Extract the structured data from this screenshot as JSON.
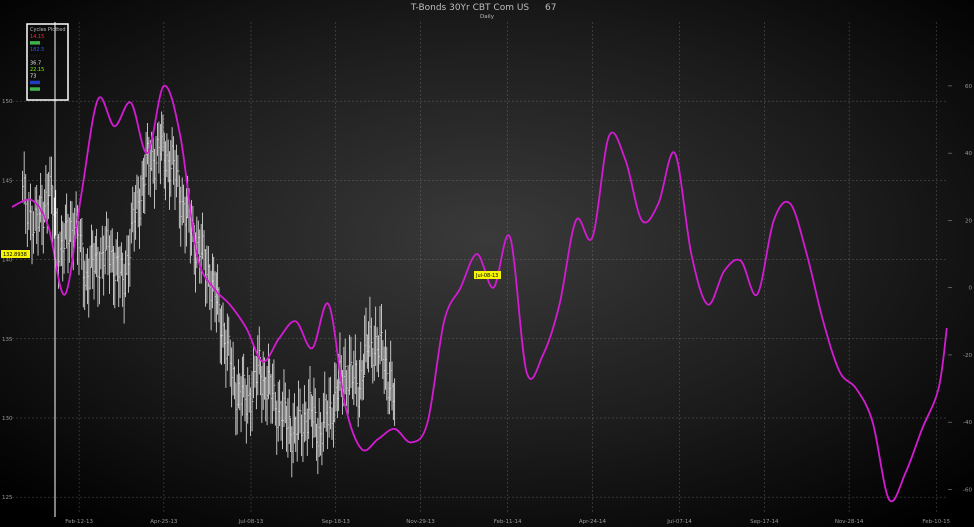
{
  "chart_data": {
    "type": "line",
    "title": "T-Bonds 30Yr CBT Com US",
    "title_value": "67",
    "subtitle": "Daily",
    "x_ticks": [
      "Feb-12-13",
      "Apr-25-13",
      "Jul-08-13",
      "Sep-18-13",
      "Nov-29-13",
      "Feb-11-14",
      "Apr-24-14",
      "Jul-07-14",
      "Sep-17-14",
      "Nov-28-14",
      "Feb-10-15"
    ],
    "xlim": [
      "Dec-17-12",
      "Feb-20-15"
    ],
    "left_axis": {
      "ticks": [
        125,
        130,
        135,
        140,
        145,
        150
      ],
      "ylim": [
        124,
        155
      ]
    },
    "right_axis": {
      "ticks": [
        -60,
        -40,
        -20,
        0,
        20,
        40,
        60
      ],
      "ylim": [
        -67,
        79
      ]
    },
    "grid": true,
    "legend": {
      "title": "Cycles Plotted",
      "placement": "top-left",
      "entries": [
        {
          "label": "14.15",
          "color": "#ff2a2a"
        },
        {
          "label": "",
          "color": "#3cb44b"
        },
        {
          "label": "182.5",
          "color": "#3b5bdb"
        },
        {
          "label": "",
          "color": "#111111"
        },
        {
          "label": "36.7",
          "color": "#e0e0e0"
        },
        {
          "label": "22.15",
          "color": "#7cfc00"
        },
        {
          "label": "73",
          "color": "#f5f5f5"
        },
        {
          "label": "",
          "color": "#1f3fbf"
        },
        {
          "label": "",
          "color": "#3cb44b"
        }
      ]
    },
    "price_label": "132.8938",
    "date_label": "Jul-08-13",
    "series": [
      {
        "axis": "left",
        "color": "#e8e8e8",
        "style": "ohlc",
        "x": [
          "Dec-26-12",
          "Jan-07-13",
          "Jan-17-13",
          "Jan-28-13",
          "Feb-07-13",
          "Feb-18-13",
          "Feb-28-13",
          "Mar-11-13",
          "Mar-21-13",
          "Apr-01-13",
          "Apr-11-13",
          "Apr-22-13",
          "May-02-13",
          "May-13-13",
          "May-23-13",
          "Jun-03-13",
          "Jun-13-13",
          "Jun-24-13",
          "Jul-04-13",
          "Jul-15-13",
          "Jul-25-13",
          "Aug-05-13",
          "Aug-15-13",
          "Aug-26-13",
          "Sep-05-13",
          "Sep-16-13",
          "Sep-26-13",
          "Oct-07-13",
          "Oct-17-13",
          "Oct-28-13",
          "Nov-07-13"
        ],
        "values": [
          144,
          142,
          144.5,
          140.5,
          142.5,
          139,
          140,
          140.5,
          138.5,
          143,
          146,
          147,
          146,
          143,
          141,
          139,
          136,
          132,
          131,
          133,
          131.5,
          130,
          129,
          130.5,
          129,
          131,
          133,
          132,
          135,
          134,
          131
        ]
      },
      {
        "axis": "right",
        "color": "#d21bd2",
        "style": "line",
        "x": [
          "Dec-17-12",
          "Jan-03-13",
          "Jan-17-13",
          "Jan-31-13",
          "Feb-14-13",
          "Feb-28-13",
          "Mar-14-13",
          "Mar-28-13",
          "Apr-11-13",
          "Apr-25-13",
          "May-09-13",
          "May-23-13",
          "Jun-06-13",
          "Jun-20-13",
          "Jul-04-13",
          "Jul-18-13",
          "Aug-01-13",
          "Aug-15-13",
          "Aug-29-13",
          "Sep-12-13",
          "Sep-26-13",
          "Oct-10-13",
          "Oct-24-13",
          "Nov-07-13",
          "Nov-21-13",
          "Dec-05-13",
          "Dec-19-13",
          "Jan-02-14",
          "Jan-16-14",
          "Jan-30-14",
          "Feb-13-14",
          "Feb-27-14",
          "Mar-13-14",
          "Mar-27-14",
          "Apr-10-14",
          "Apr-24-14",
          "May-08-14",
          "May-22-14",
          "Jun-05-14",
          "Jun-19-14",
          "Jul-03-14",
          "Jul-17-14",
          "Jul-31-14",
          "Aug-14-14",
          "Aug-28-14",
          "Sep-11-14",
          "Sep-25-14",
          "Oct-09-14",
          "Oct-23-14",
          "Nov-06-14",
          "Nov-20-14",
          "Dec-04-14",
          "Dec-18-14",
          "Jan-01-15",
          "Jan-15-15",
          "Jan-29-15",
          "Feb-12-15",
          "Feb-19-15"
        ],
        "values": [
          24,
          26,
          18,
          -2,
          28,
          56,
          48,
          55,
          40,
          60,
          45,
          10,
          0,
          -5,
          -12,
          -22,
          -15,
          -10,
          -18,
          -5,
          -35,
          -48,
          -45,
          -42,
          -46,
          -40,
          -10,
          0,
          10,
          0,
          15,
          -25,
          -20,
          -5,
          20,
          15,
          45,
          38,
          20,
          25,
          40,
          10,
          -5,
          5,
          8,
          -2,
          20,
          25,
          10,
          -10,
          -25,
          -30,
          -40,
          -63,
          -55,
          -42,
          -30,
          -12
        ]
      }
    ]
  }
}
